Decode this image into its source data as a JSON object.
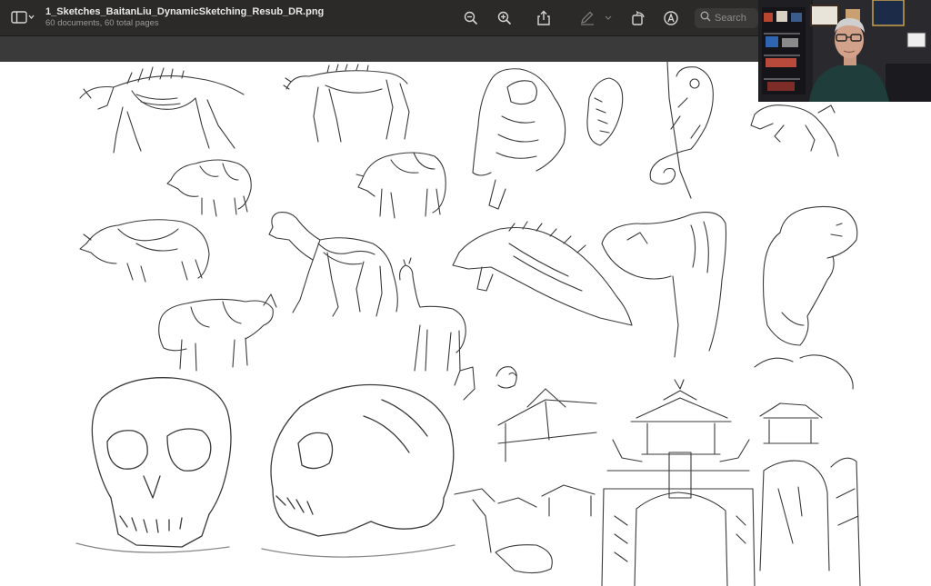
{
  "toolbar": {
    "title": "1_Sketches_BaitanLiu_DynamicSketching_Resub_DR.png",
    "subtitle": "60 documents, 60 total pages",
    "search_placeholder": "Search",
    "icons": [
      "sidebar-toggle-icon",
      "zoom-out-icon",
      "zoom-in-icon",
      "share-icon",
      "markup-pen-icon",
      "rotate-icon",
      "annotate-icon",
      "search-icon"
    ]
  },
  "colors": {
    "toolbar_bg": "#2b2a29",
    "band_bg": "#3a3a3a",
    "sketch_ink": "#3a3a3a",
    "canvas_bg": "#ffffff"
  }
}
